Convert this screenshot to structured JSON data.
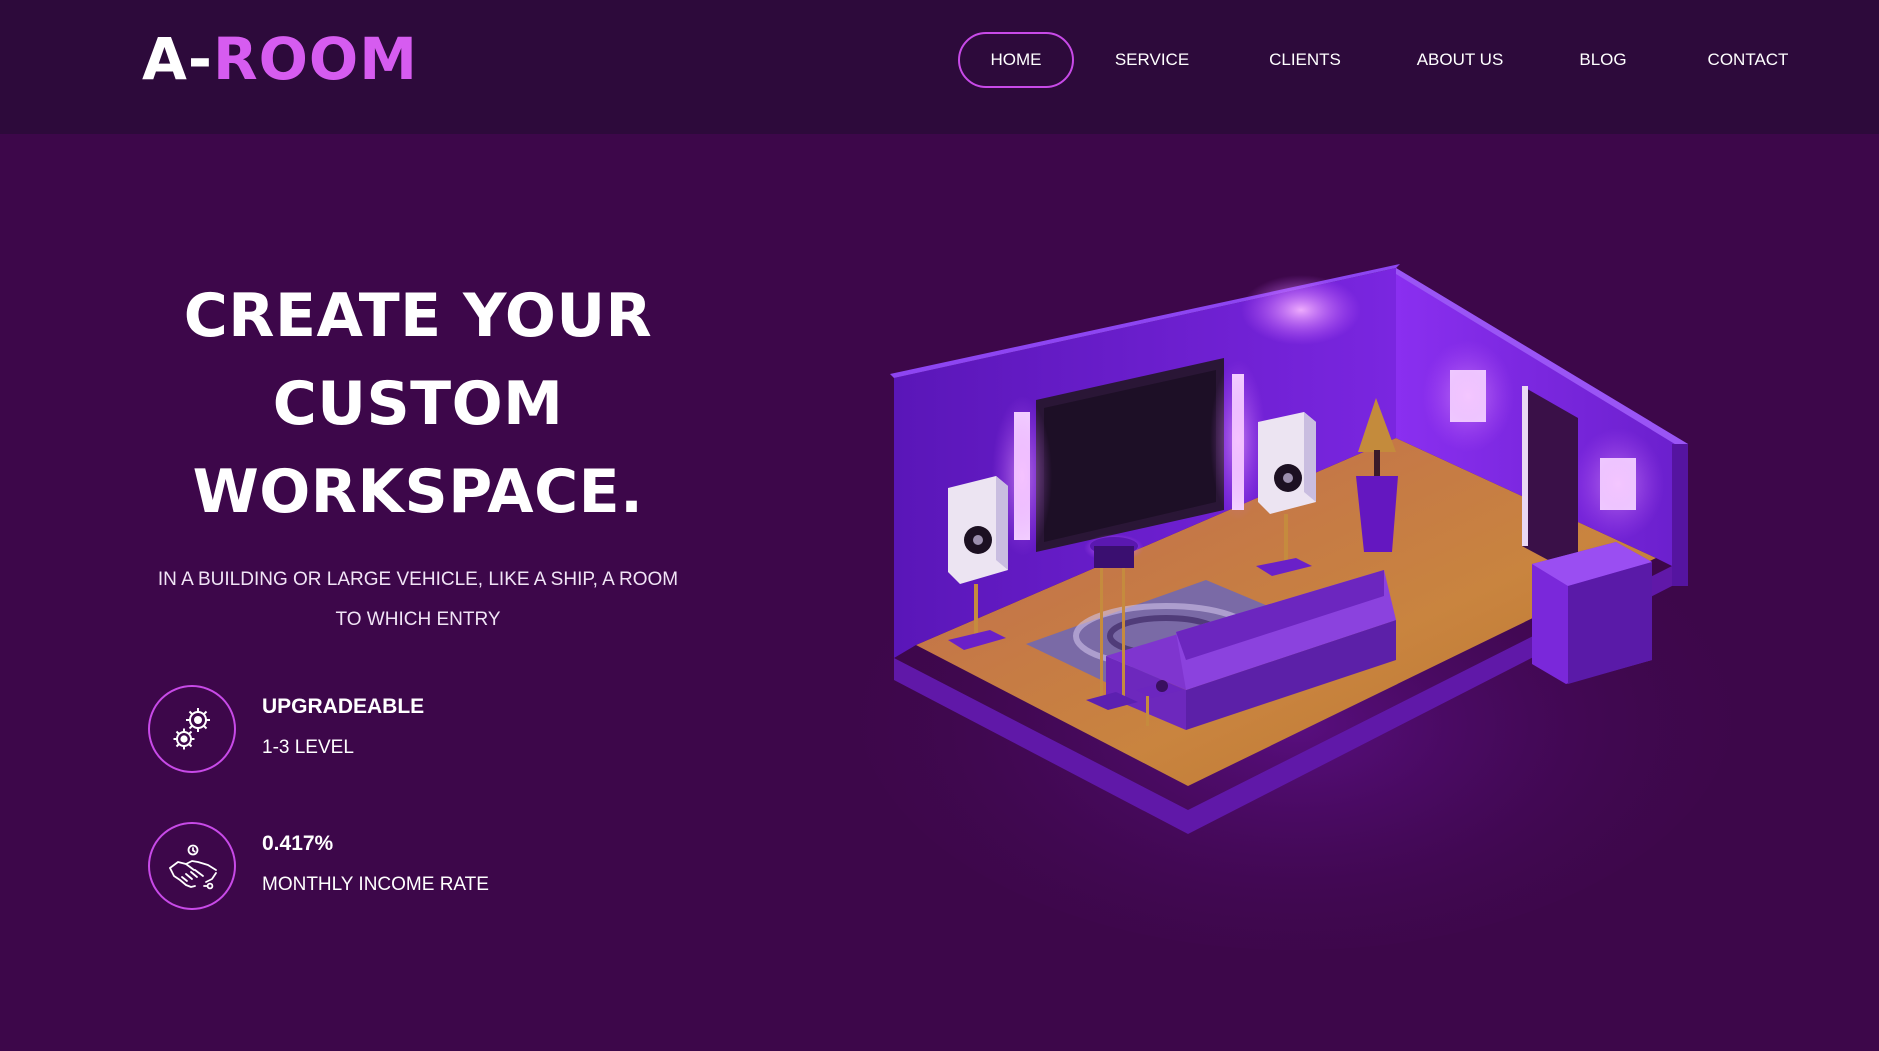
{
  "brand": {
    "logo_part1": "A-",
    "logo_part2": "ROOM"
  },
  "nav": {
    "items": [
      {
        "label": "HOME",
        "active": true
      },
      {
        "label": "SERVICE",
        "active": false
      },
      {
        "label": "CLIENTS",
        "active": false
      },
      {
        "label": "ABOUT US",
        "active": false
      },
      {
        "label": "BLOG",
        "active": false
      },
      {
        "label": "CONTACT",
        "active": false
      }
    ]
  },
  "hero": {
    "title_lines": [
      "CREATE YOUR",
      "CUSTOM",
      "WORKSPACE."
    ],
    "subtitle_lines": [
      "IN A BUILDING OR LARGE VEHICLE, LIKE A SHIP, A ROOM",
      "TO WHICH ENTRY"
    ]
  },
  "features": [
    {
      "icon": "gears-icon",
      "title": "UPGRADEABLE",
      "subtitle": "1-3 LEVEL"
    },
    {
      "icon": "handshake-icon",
      "title": "0.417%",
      "subtitle": "MONTHLY INCOME RATE"
    }
  ],
  "colors": {
    "background": "#3d074a",
    "header": "#2d0a3b",
    "accent": "#d65cf0",
    "border_accent": "#c84ae8"
  },
  "illustration": {
    "icon": "isometric-room-illustration"
  }
}
